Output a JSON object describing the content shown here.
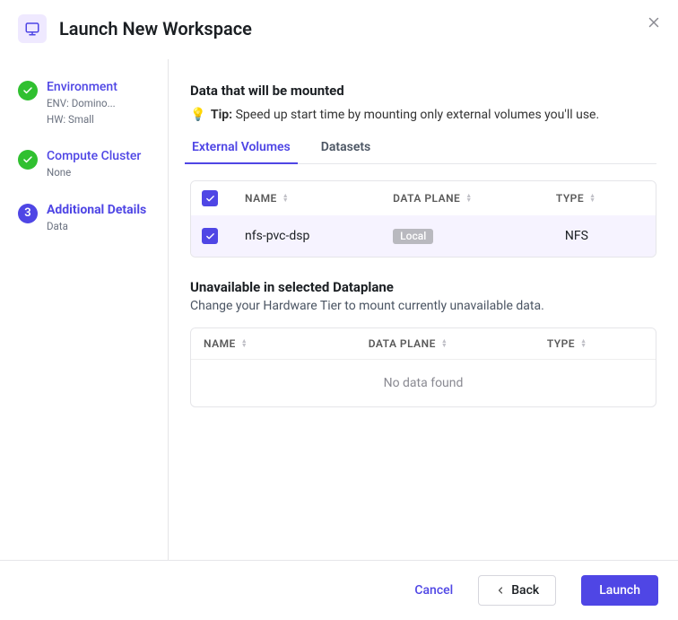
{
  "header": {
    "title": "Launch New Workspace"
  },
  "steps": [
    {
      "title": "Environment",
      "sub1": "ENV: Domino...",
      "sub2": "HW: Small"
    },
    {
      "title": "Compute Cluster",
      "sub1": "None"
    },
    {
      "title": "Additional Details",
      "sub1": "Data",
      "num": "3"
    }
  ],
  "main": {
    "heading": "Data that will be mounted",
    "tip_prefix": "Tip:",
    "tip_text": " Speed up start time by mounting only external volumes you'll use."
  },
  "tabs": {
    "volumes": "External Volumes",
    "datasets": "Datasets"
  },
  "columns": {
    "name": "NAME",
    "dataplane": "DATA PLANE",
    "type": "TYPE"
  },
  "rows": [
    {
      "name": "nfs-pvc-dsp",
      "dataplane_badge": "Local",
      "type": "NFS"
    }
  ],
  "unavailable": {
    "title": "Unavailable in selected Dataplane",
    "subtitle": "Change your Hardware Tier to mount currently unavailable data.",
    "empty": "No data found"
  },
  "footer": {
    "cancel": "Cancel",
    "back": "Back",
    "launch": "Launch"
  }
}
